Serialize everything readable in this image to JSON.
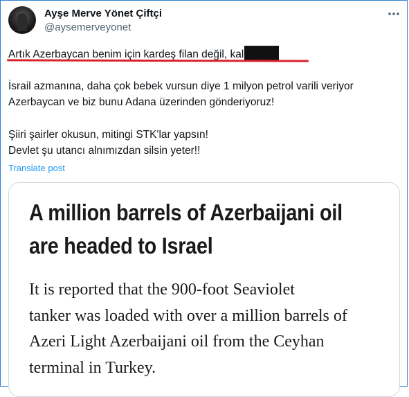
{
  "post": {
    "display_name": "Ayşe Merve Yönet Çiftçi",
    "handle": "@aysemerveyonet",
    "line1": "Artık Azerbaycan benim için kardeş filan değil, kal",
    "paragraph2_line1": "İsrail azmanına, daha çok bebek vursun diye 1 milyon petrol varili veriyor",
    "paragraph2_line2": "Azerbaycan ve biz bunu Adana üzerinden gönderiyoruz!",
    "paragraph3_line1": "Şiiri şairler okusun, mitingi STK'lar yapsın!",
    "paragraph3_line2": "Devlet şu utancı alnımızdan silsin yeter!!",
    "translate_label": "Translate post"
  },
  "card": {
    "headline_line1": "A million barrels of Azerbaijani oil",
    "headline_line2": "are headed to Israel",
    "body_line1": "It is reported that the 900-foot Seaviolet",
    "body_line2": "tanker was loaded with over a million barrels of",
    "body_line3": "Azeri Light Azerbaijani oil from the Ceyhan",
    "body_line4": "terminal in Turkey."
  },
  "icons": {
    "more": "more-options-icon",
    "avatar": "profile-avatar"
  },
  "colors": {
    "text": "#0f1419",
    "secondary": "#536471",
    "link": "#1d9bf0",
    "annotation_underline": "#d9232a",
    "border": "#cfd9de"
  }
}
